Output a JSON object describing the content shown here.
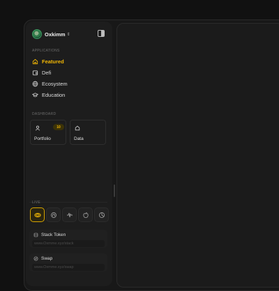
{
  "profile": {
    "username": "Oxkimm"
  },
  "sections": {
    "applications": "APPLICATIONS",
    "dashboard": "DASHBOARD",
    "live": "LIVE"
  },
  "nav": [
    {
      "label": "Featured",
      "icon": "home-icon",
      "active": true
    },
    {
      "label": "Defi",
      "icon": "wallet-icon",
      "active": false
    },
    {
      "label": "Ecosystem",
      "icon": "globe-icon",
      "active": false
    },
    {
      "label": "Education",
      "icon": "graduation-cap-icon",
      "active": false
    }
  ],
  "dashboard": {
    "portfolio": {
      "label": "Portfolio",
      "badge": "10"
    },
    "data": {
      "label": "Data"
    }
  },
  "live_icons": [
    "coin-icon",
    "shield-icon",
    "waveform-icon",
    "apple-icon",
    "pie-chart-icon"
  ],
  "tools": [
    {
      "title": "Stack Token",
      "url": "www.Oxmme.xyz/stack",
      "icon": "stack-icon"
    },
    {
      "title": "Swap",
      "url": "www.Oxmme.xyz/swap",
      "icon": "swap-icon"
    }
  ],
  "colors": {
    "accent": "#f2b705",
    "background": "#111111",
    "panel": "#1d1d1d"
  }
}
